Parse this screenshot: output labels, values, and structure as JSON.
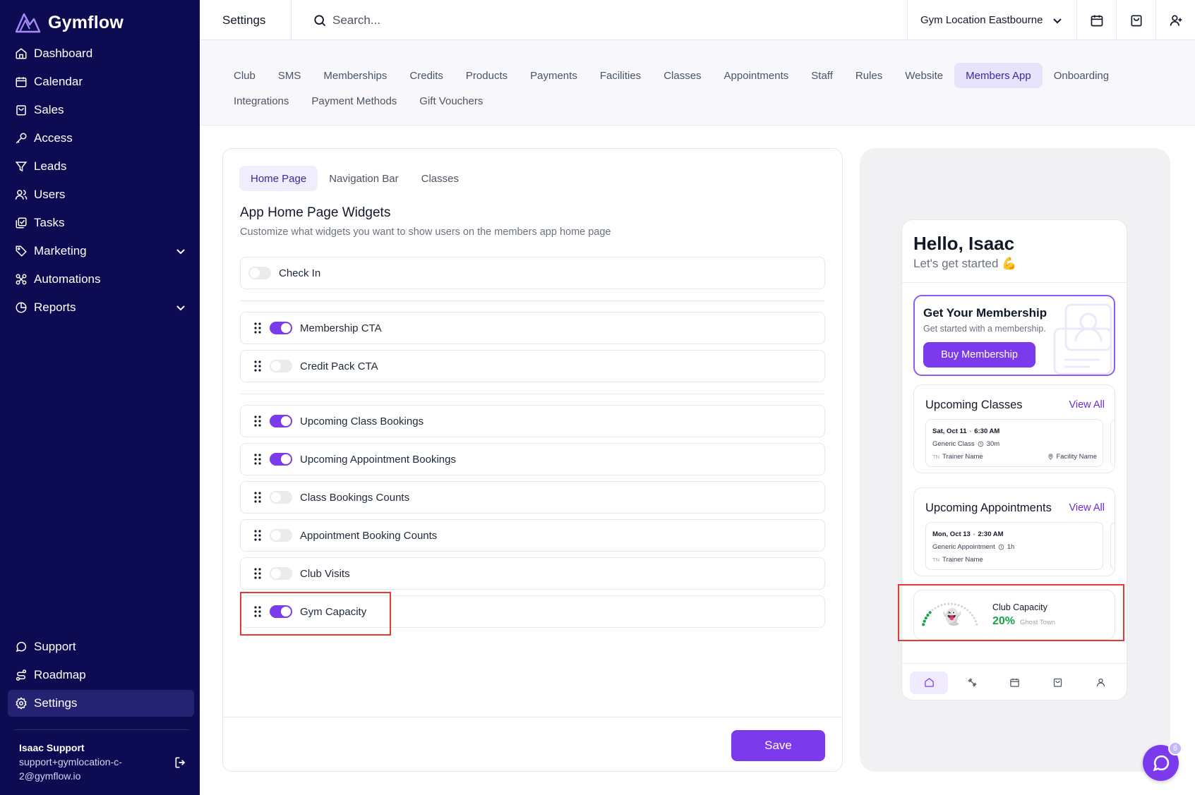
{
  "brand": {
    "name": "Gymflow"
  },
  "sidebar": {
    "items": [
      {
        "label": "Dashboard",
        "icon": "home-icon"
      },
      {
        "label": "Calendar",
        "icon": "calendar-icon"
      },
      {
        "label": "Sales",
        "icon": "shopping-bag-icon"
      },
      {
        "label": "Access",
        "icon": "key-icon"
      },
      {
        "label": "Leads",
        "icon": "filter-icon"
      },
      {
        "label": "Users",
        "icon": "users-icon"
      },
      {
        "label": "Tasks",
        "icon": "tasks-icon"
      },
      {
        "label": "Marketing",
        "icon": "tag-icon"
      },
      {
        "label": "Automations",
        "icon": "automation-icon"
      },
      {
        "label": "Reports",
        "icon": "pie-chart-icon"
      }
    ],
    "bottom_items": [
      {
        "label": "Support",
        "icon": "chat-icon"
      },
      {
        "label": "Roadmap",
        "icon": "route-icon"
      },
      {
        "label": "Settings",
        "icon": "gear-icon",
        "active": true
      }
    ],
    "user": {
      "name": "Isaac Support",
      "email": "support+gymlocation-c-2@gymflow.io"
    }
  },
  "topbar": {
    "title": "Settings",
    "search_placeholder": "Search...",
    "location": "Gym Location Eastbourne"
  },
  "settings_tabs": {
    "row1": [
      "Club",
      "SMS",
      "Memberships",
      "Credits",
      "Products",
      "Payments",
      "Facilities",
      "Classes",
      "Appointments",
      "Staff",
      "Rules",
      "Website",
      "Members App",
      "Onboarding"
    ],
    "row2": [
      "Integrations",
      "Payment Methods",
      "Gift Vouchers"
    ],
    "active": "Members App"
  },
  "main": {
    "subtabs": [
      "Home Page",
      "Navigation Bar",
      "Classes"
    ],
    "active_subtab": "Home Page",
    "title": "App Home Page Widgets",
    "description": "Customize what widgets you want to show users on the members app home page",
    "check_in": {
      "label": "Check In",
      "enabled": false
    },
    "widgets": [
      {
        "label": "Membership CTA",
        "enabled": true
      },
      {
        "label": "Credit Pack CTA",
        "enabled": false
      },
      {
        "label": "Upcoming Class Bookings",
        "enabled": true
      },
      {
        "label": "Upcoming Appointment Bookings",
        "enabled": true
      },
      {
        "label": "Class Bookings Counts",
        "enabled": false
      },
      {
        "label": "Appointment Booking Counts",
        "enabled": false
      },
      {
        "label": "Club Visits",
        "enabled": false
      },
      {
        "label": "Gym Capacity",
        "enabled": true
      }
    ],
    "save_label": "Save"
  },
  "preview": {
    "greeting": "Hello, Isaac",
    "subgreeting": "Let's get started 💪",
    "membership": {
      "title": "Get Your Membership",
      "subtitle": "Get started with a membership.",
      "button": "Buy Membership"
    },
    "upcoming_classes": {
      "title": "Upcoming Classes",
      "link": "View All",
      "date": "Sat, Oct 11",
      "time": "6:30 AM",
      "name": "Generic Class",
      "duration": "30m",
      "initials": "TN",
      "trainer": "Trainer Name",
      "facility": "Facility Name"
    },
    "upcoming_appointments": {
      "title": "Upcoming Appointments",
      "link": "View All",
      "date": "Mon, Oct 13",
      "time": "2:30 AM",
      "name": "Generic Appointment",
      "duration": "1h",
      "initials": "TN",
      "trainer": "Trainer Name"
    },
    "capacity": {
      "title": "Club Capacity",
      "value": "20%",
      "status": "Ghost Town",
      "fraction": 0.2
    },
    "bottom_nav": [
      "home-icon",
      "dumbbell-icon",
      "calendar-icon",
      "shopping-bag-icon",
      "user-icon"
    ]
  },
  "chat": {
    "badge": "6"
  },
  "colors": {
    "sidebar": "#0d0c52",
    "accent": "#7c3aed",
    "highlight": "#e53935",
    "capacity_green": "#16a34a"
  }
}
